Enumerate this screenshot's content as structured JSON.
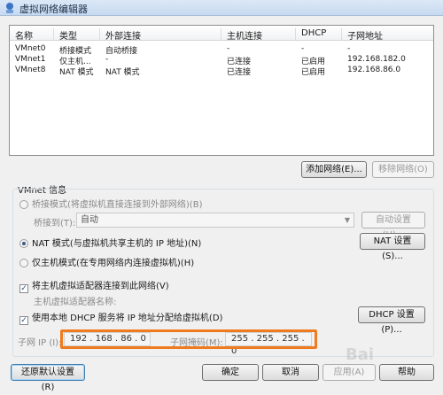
{
  "window": {
    "title": "虚拟网络编辑器",
    "icon": "network-editor-icon"
  },
  "table": {
    "columns": [
      "名称",
      "类型",
      "外部连接",
      "主机连接",
      "DHCP",
      "子网地址"
    ],
    "rows": [
      [
        "VMnet0",
        "桥接模式",
        "自动桥接",
        "-",
        "-",
        "-"
      ],
      [
        "VMnet1",
        "仅主机...",
        "-",
        "已连接",
        "已启用",
        "192.168.182.0"
      ],
      [
        "VMnet8",
        "NAT 模式",
        "NAT 模式",
        "已连接",
        "已启用",
        "192.168.86.0"
      ]
    ]
  },
  "table_buttons": {
    "add": "添加网络(E)...",
    "remove": "移除网络(O)"
  },
  "vmnet_info": {
    "label": "VMnet 信息",
    "bridge_radio": "桥接模式(将虚拟机直接连接到外部网络)(B)",
    "bridge_to_label": "桥接到(T):",
    "bridge_to_value": "自动",
    "auto_settings": "自动设置(U)...",
    "nat_radio": "NAT 模式(与虚拟机共享主机的 IP 地址)(N)",
    "nat_settings": "NAT 设置(S)...",
    "host_only_radio": "仅主机模式(在专用网络内连接虚拟机)(H)",
    "connect_adapter_check": "将主机虚拟适配器连接到此网络(V)",
    "adapter_name_label": "主机虚拟适配器名称:",
    "dhcp_check": "使用本地 DHCP 服务将 IP 地址分配给虚拟机(D)",
    "dhcp_settings": "DHCP 设置(P)...",
    "selected_mode": "nat",
    "connect_adapter_checked": true,
    "dhcp_checked": true
  },
  "subnet": {
    "ip_label": "子网 IP (I):",
    "ip_value": "192 . 168 . 86  .  0",
    "mask_label": "子网掩码(M):",
    "mask_value": "255 . 255 . 255 . 0",
    "highlight_color": "#f07b1f"
  },
  "footer": {
    "restore": "还原默认设置(R)",
    "ok": "确定",
    "cancel": "取消",
    "apply": "应用(A)",
    "help": "帮助"
  },
  "watermark": "Bai"
}
